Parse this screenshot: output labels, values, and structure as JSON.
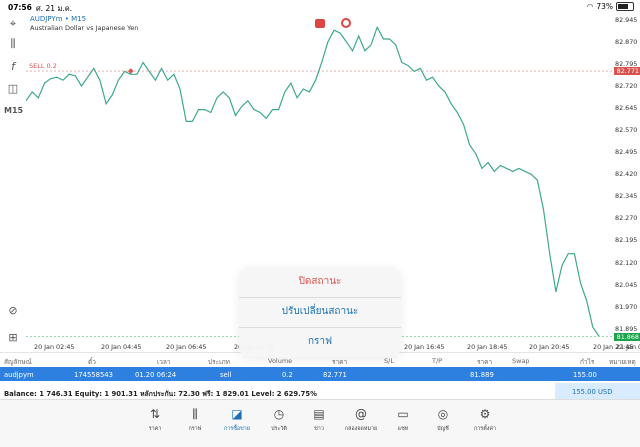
{
  "status_bar": {
    "time": "07:56",
    "date": "ศ. 21 ม.ค.",
    "battery": "73%",
    "battery_level": 0.73
  },
  "symbol": {
    "title": "AUDJPYm • M15",
    "subtitle": "Australian Dollar vs Japanese Yen"
  },
  "timeframe": "M15",
  "sell_label": "SELL 0.2",
  "price_axis": [
    "82.945",
    "82.870",
    "82.795",
    "82.720",
    "82.645",
    "82.570",
    "82.495",
    "82.420",
    "82.345",
    "82.270",
    "82.195",
    "82.120",
    "82.045",
    "81.970",
    "81.895"
  ],
  "current_price_tag": "82.771",
  "bid_price_tag": "81.868",
  "time_axis": [
    "20 Jan 02:45",
    "20 Jan 04:45",
    "20 Jan 06:45",
    "20 Jan 08:45",
    "20 Jan 16:45",
    "20 Jan 18:45",
    "20 Jan 20:45",
    "20 Jan 22:45",
    "21 Jan 00:45"
  ],
  "chart_data": {
    "type": "line",
    "ylim": [
      81.86,
      82.965
    ],
    "series": [
      {
        "values": [
          82.67,
          82.7,
          82.68,
          82.73,
          82.745,
          82.75,
          82.74,
          82.76,
          82.755,
          82.72,
          82.75,
          82.78,
          82.74,
          82.66,
          82.69,
          82.74,
          82.77,
          82.76,
          82.76,
          82.8,
          82.77,
          82.74,
          82.78,
          82.74,
          82.76,
          82.71,
          82.6,
          82.6,
          82.64,
          82.64,
          82.63,
          82.68,
          82.7,
          82.68,
          82.62,
          82.65,
          82.67,
          82.64,
          82.63,
          82.61,
          82.64,
          82.64,
          82.7,
          82.73,
          82.68,
          82.71,
          82.7,
          82.74,
          82.8,
          82.87,
          82.91,
          82.9,
          82.87,
          82.84,
          82.89,
          82.84,
          82.86,
          82.92,
          82.88,
          82.88,
          82.86,
          82.8,
          82.79,
          82.77,
          82.78,
          82.74,
          82.75,
          82.72,
          82.7,
          82.66,
          82.63,
          82.59,
          82.52,
          82.49,
          82.44,
          82.46,
          82.43,
          82.45,
          82.44,
          82.43,
          82.44,
          82.43,
          82.42,
          82.4,
          82.3,
          82.15,
          82.02,
          82.11,
          82.15,
          82.15,
          82.05,
          81.99,
          81.9,
          81.87
        ]
      }
    ]
  },
  "action_sheet": {
    "close": "ปิดสถานะ",
    "modify": "ปรับเปลี่ยนสถานะ",
    "chart": "กราฟ"
  },
  "table": {
    "headers": [
      "สัญลักษณ์",
      "ตั๋ว",
      "เวลา",
      "ประเภท",
      "Volume",
      "ราคา",
      "S/L",
      "T/P",
      "ราคา",
      "Swap",
      "กำไร",
      "หมายเหตุ"
    ],
    "row": {
      "symbol": "audjpym",
      "ticket": "174558543",
      "time": "01.20 06:24",
      "type": "sell",
      "volume": "0.2",
      "price": "82.771",
      "current": "81.889",
      "profit": "155.00"
    }
  },
  "balance": {
    "text": "Balance: 1 746.31 Equity: 1 901.31 หลักประกัน: 72.30 ฟรี: 1 829.01 Level: 2 629.75%",
    "total": "155.00 USD"
  },
  "tabs": [
    "ราคา",
    "กราฟ",
    "การซื้อขาย",
    "ประวัติ",
    "ข่าว",
    "กล่องจดหมาย",
    "แชท",
    "บัญชี",
    "การตั้งค่า"
  ],
  "colors": {
    "accent": "#1a6fb6",
    "line": "#3fa88e",
    "sell": "#d9534f",
    "bid": "#1aa34a"
  },
  "icons": [
    "crosshair-icon",
    "candlestick-icon",
    "function-icon",
    "objects-icon",
    "zoom-icon",
    "add-icon"
  ]
}
